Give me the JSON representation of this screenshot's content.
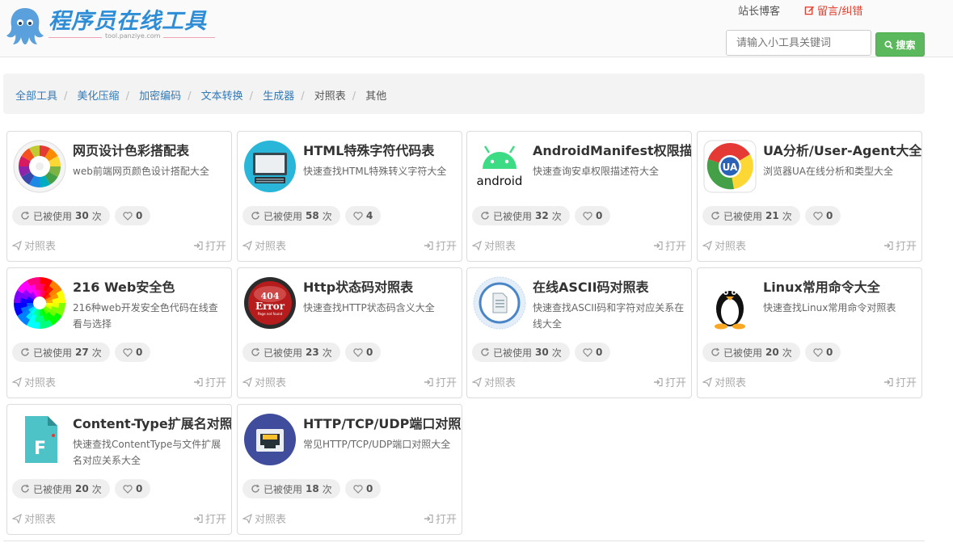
{
  "header": {
    "logo_text": "程序员在线工具",
    "logo_sub": "tool.panziye.com",
    "link_blog": "站长博客",
    "link_feedback": "留言/纠错",
    "search_placeholder": "请输入小工具关键词",
    "search_button": "搜索"
  },
  "breadcrumb": [
    "全部工具",
    "美化压缩",
    "加密编码",
    "文本转换",
    "生成器",
    "对照表",
    "其他"
  ],
  "card_common": {
    "used_prefix": "已被使用",
    "used_suffix": "次",
    "category_label": "对照表",
    "open_label": "打开"
  },
  "cards": [
    {
      "title": "网页设计色彩搭配表",
      "desc": "web前端网页颜色设计搭配大全",
      "used": "30",
      "likes": "0",
      "icon": "color-wheel-icon"
    },
    {
      "title": "HTML特殊字符代码表",
      "desc": "快速查找HTML特殊转义字符大全",
      "used": "58",
      "likes": "4",
      "icon": "monitor-nbsp-icon",
      "icon_text": "&nbsp;"
    },
    {
      "title": "AndroidManifest权限描",
      "desc": "快速查询安卓权限描述符大全",
      "used": "32",
      "likes": "0",
      "icon": "android-icon",
      "icon_text": "android"
    },
    {
      "title": "UA分析/User-Agent大全",
      "desc": "浏览器UA在线分析和类型大全",
      "used": "21",
      "likes": "0",
      "icon": "ua-browser-icon",
      "icon_text": "UA"
    },
    {
      "title": "216 Web安全色",
      "desc": "216种web开发安全色代码在线查看与选择",
      "used": "27",
      "likes": "0",
      "icon": "rainbow-circle-icon"
    },
    {
      "title": "Http状态码对照表",
      "desc": "快速查找HTTP状态码含义大全",
      "used": "23",
      "likes": "0",
      "icon": "error-404-icon",
      "icon_text": "404",
      "icon_text2": "Error",
      "icon_text3": "Page not found"
    },
    {
      "title": "在线ASCII码对照表",
      "desc": "快速查找ASCII码和字符对应关系在线大全",
      "used": "30",
      "likes": "0",
      "icon": "document-circle-icon"
    },
    {
      "title": "Linux常用命令大全",
      "desc": "快速查找Linux常用命令对照表",
      "used": "20",
      "likes": "0",
      "icon": "tux-penguin-icon"
    },
    {
      "title": "Content-Type扩展名对照",
      "desc": "快速查找ContentType与文件扩展名对应关系大全",
      "used": "20",
      "likes": "0",
      "icon": "file-f-icon",
      "icon_text": "F"
    },
    {
      "title": "HTTP/TCP/UDP端口对照",
      "desc": "常见HTTP/TCP/UDP端口对照大全",
      "used": "18",
      "likes": "0",
      "icon": "ethernet-port-icon"
    }
  ]
}
